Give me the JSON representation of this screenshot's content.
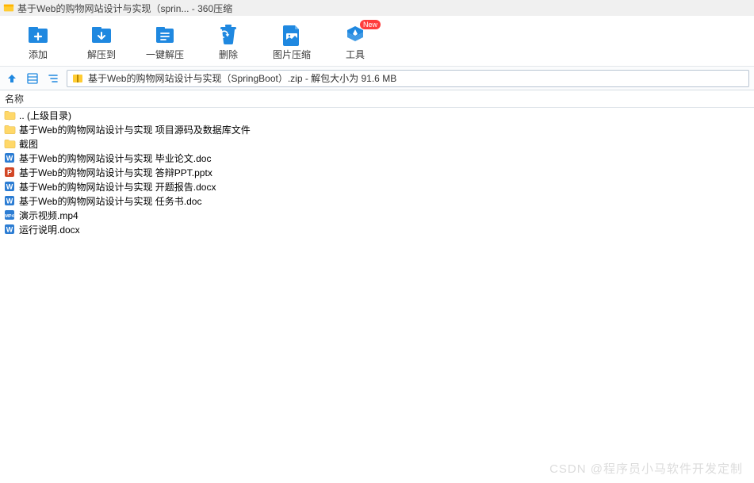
{
  "window": {
    "title": "基于Web的购物网站设计与实现（sprin... - 360压缩"
  },
  "toolbar": {
    "add": {
      "label": "添加"
    },
    "extract": {
      "label": "解压到"
    },
    "one_click": {
      "label": "一键解压"
    },
    "delete": {
      "label": "删除"
    },
    "img_comp": {
      "label": "图片压缩"
    },
    "tools": {
      "label": "工具",
      "badge": "New"
    }
  },
  "path": {
    "text": "基于Web的购物网站设计与实现（SpringBoot）.zip - 解包大小为 91.6 MB"
  },
  "columns": {
    "name": "名称"
  },
  "files": [
    {
      "icon": "folder",
      "name": ".. (上级目录)"
    },
    {
      "icon": "folder",
      "name": "基于Web的购物网站设计与实现 项目源码及数据库文件"
    },
    {
      "icon": "folder",
      "name": "截图"
    },
    {
      "icon": "doc",
      "name": "基于Web的购物网站设计与实现 毕业论文.doc"
    },
    {
      "icon": "ppt",
      "name": "基于Web的购物网站设计与实现 答辩PPT.pptx"
    },
    {
      "icon": "doc",
      "name": "基于Web的购物网站设计与实现 开题报告.docx"
    },
    {
      "icon": "doc",
      "name": "基于Web的购物网站设计与实现 任务书.doc"
    },
    {
      "icon": "mp4",
      "name": "演示视频.mp4"
    },
    {
      "icon": "doc",
      "name": "运行说明.docx"
    }
  ],
  "watermark": "CSDN @程序员小马软件开发定制"
}
